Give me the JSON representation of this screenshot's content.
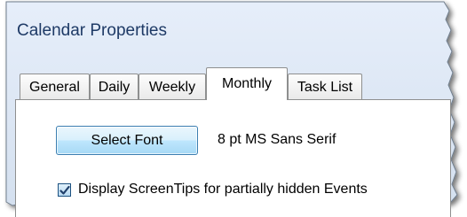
{
  "window": {
    "title": "Calendar Properties"
  },
  "tabs": [
    {
      "label": "General",
      "active": false
    },
    {
      "label": "Daily",
      "active": false
    },
    {
      "label": "Weekly",
      "active": false
    },
    {
      "label": "Monthly",
      "active": true
    },
    {
      "label": "Task List",
      "active": false
    }
  ],
  "monthly": {
    "select_font_button": "Select Font",
    "font_description": "8 pt MS Sans Serif",
    "screentips_checkbox": {
      "label": "Display ScreenTips for partially hidden Events",
      "checked": true
    }
  },
  "colors": {
    "title_text": "#1e3a66",
    "frame_fill": "#dde8f5",
    "button_border": "#3c7fb1",
    "checkmark": "#1f3f6b"
  }
}
